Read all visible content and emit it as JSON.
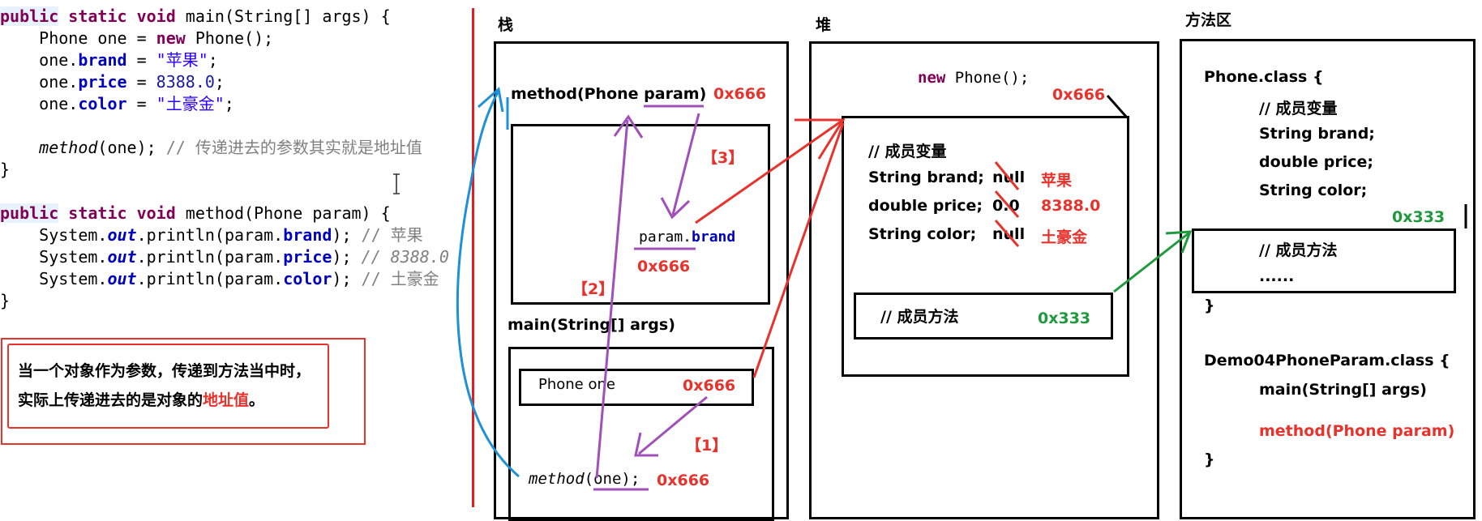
{
  "code": {
    "main_sig": [
      "public",
      " ",
      "static",
      " ",
      "void",
      " main(String[] args) {"
    ],
    "l1": "    Phone one = ",
    "l1_new": "new",
    "l1_end": " Phone();",
    "l2a": "    one.",
    "l2_field": "brand",
    "l2b": " = ",
    "l2_str": "\"苹果\"",
    "l2_end": ";",
    "l3a": "    one.",
    "l3_field": "price",
    "l3b": " = ",
    "l3_num": "8388.0",
    "l3_end": ";",
    "l4a": "    one.",
    "l4_field": "color",
    "l4b": " = ",
    "l4_str": "\"土豪金\"",
    "l4_end": ";",
    "l5_method": "method",
    "l5_args": "(one); ",
    "l5_cmt": "// 传递进去的参数其实就是地址值",
    "close1": "}",
    "m_public": "public",
    "m_rest_kw": "static",
    "m_void": "void",
    "m_sig": " method(Phone param) {",
    "p1a": "    System.",
    "p_out": "out",
    "p1b": ".println(param.",
    "p1_field": "brand",
    "p1c": "); ",
    "p1_cmt": "// 苹果",
    "p2_field": "price",
    "p2_cmt": "// 8388.0",
    "p3_field": "color",
    "p3_cmt": "// 土豪金",
    "close2": "}"
  },
  "note": {
    "line1": "当一个对象作为参数，传递到方法当中时，",
    "line2a": "实际上传递进去的是对象的",
    "line2b": "地址值",
    "line2c": "。"
  },
  "stack": {
    "title": "栈",
    "method_frame": "method(Phone param)",
    "method_addr": "0x666",
    "step3": "【3】",
    "param_brand_a": "param.",
    "param_brand_b": "brand",
    "param_addr": "0x666",
    "step2": "【2】",
    "main_frame": "main(String[] args)",
    "phone_one": "Phone  one",
    "phone_addr": "0x666",
    "step1": "【1】",
    "method_call_a": "method",
    "method_call_b": "(one);",
    "method_call_addr": "0x666"
  },
  "heap": {
    "title": "堆",
    "new_phone_a": "new",
    "new_phone_b": " Phone();",
    "obj_addr": "0x666",
    "members_cmt": "// 成员变量",
    "brand_decl": "String brand;",
    "brand_old": "null",
    "brand_new": "苹果",
    "price_decl": "double price;",
    "price_old": "0.0",
    "price_new": "8388.0",
    "color_decl": "String color;",
    "color_old": "null",
    "color_new": "土豪金",
    "methods_cmt": "// 成员方法",
    "methods_addr": "0x333"
  },
  "method_area": {
    "title": "方法区",
    "phone_class": "Phone.class {",
    "members_cmt": "// 成员变量",
    "brand": "String brand;",
    "price": "double price;",
    "color": "String color;",
    "methods_addr": "0x333",
    "methods_cmt": "// 成员方法",
    "dots": "......",
    "close": "}",
    "demo_class": "Demo04PhoneParam.class {",
    "main": "main(String[] args)",
    "method": "method(Phone param)",
    "close2": "}"
  },
  "colors": {
    "red": "#e8322c",
    "green": "#1e9a3c",
    "blue": "#1e90d8",
    "purple": "#a050b8"
  }
}
